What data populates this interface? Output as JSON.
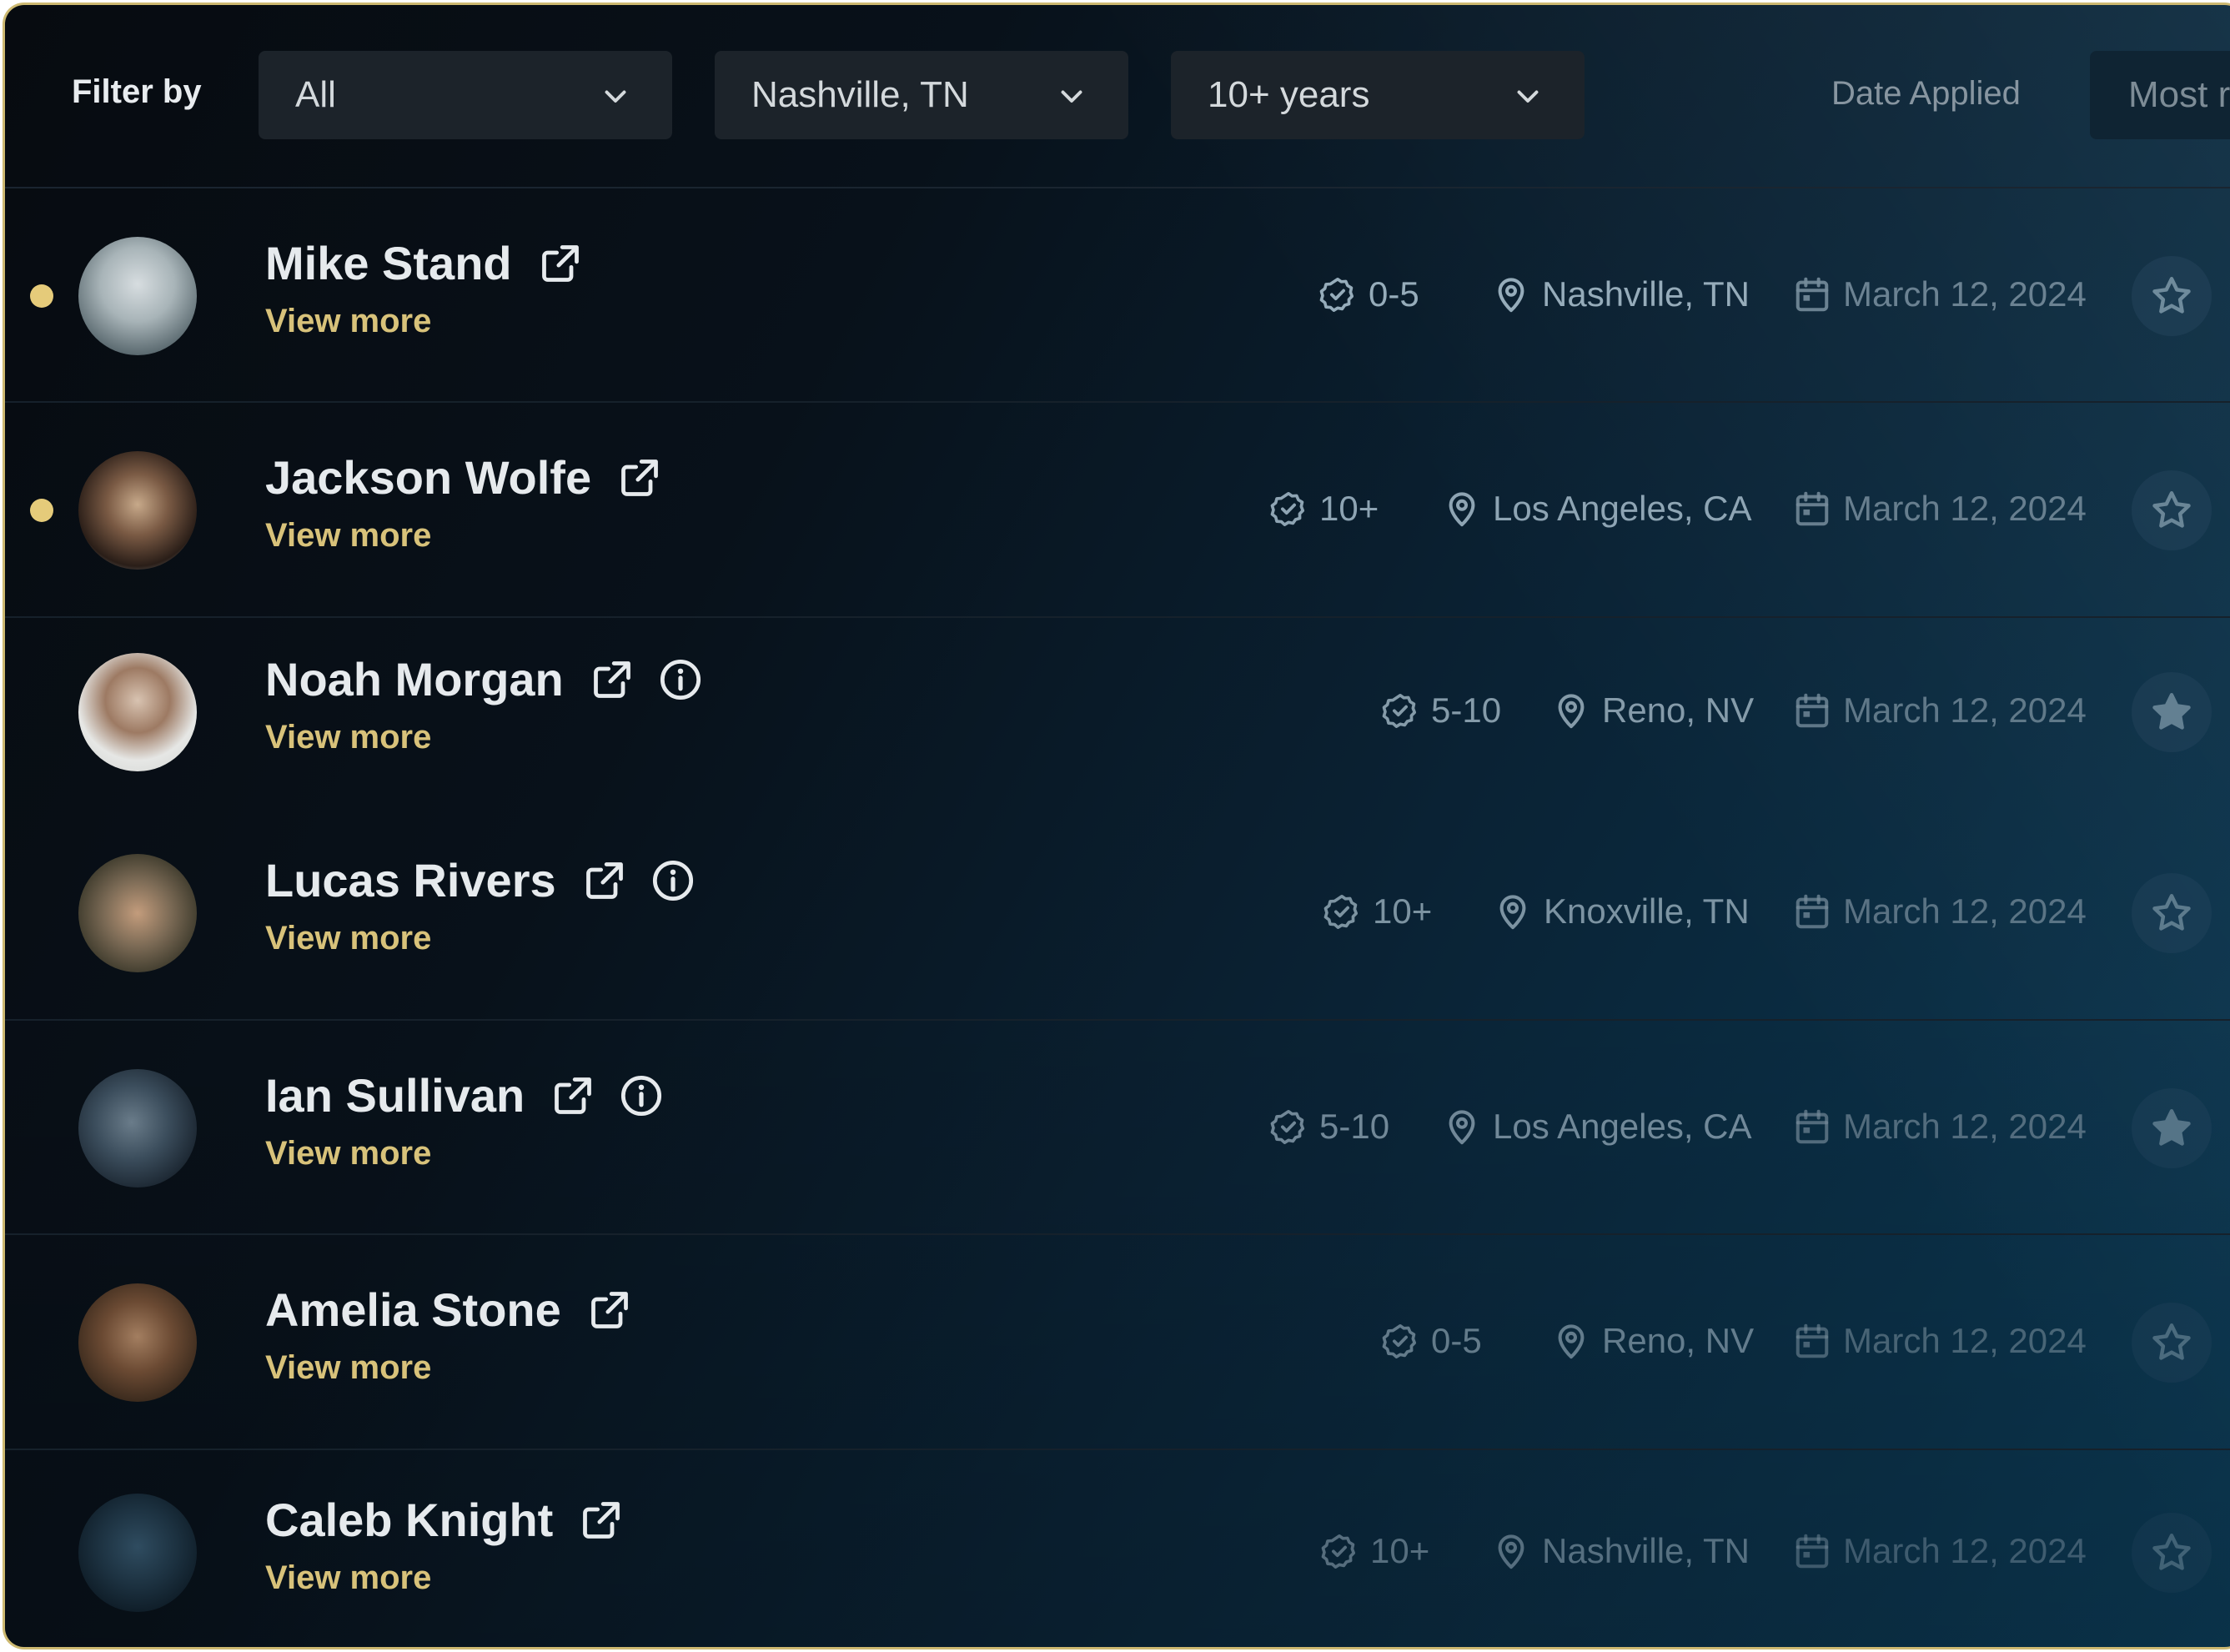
{
  "header": {
    "filter_label": "Filter by",
    "selects": [
      {
        "value": "All"
      },
      {
        "value": "Nashville, TN"
      },
      {
        "value": "10+ years"
      }
    ],
    "sort_label": "Date Applied",
    "sort_value": "Most r"
  },
  "colors": {
    "accent_gold": "#d8c27a",
    "unread_dot": "#e5cb7a",
    "background_dark": "#070b10",
    "background_teal": "#0b3a55"
  },
  "candidates": [
    {
      "name": "Mike Stand",
      "view_more": "View more",
      "experience": "0-5",
      "location": "Nashville, TN",
      "date": "March 12, 2024",
      "unread": true,
      "info": false,
      "starred": false
    },
    {
      "name": "Jackson Wolfe",
      "view_more": "View more",
      "experience": "10+",
      "location": "Los Angeles, CA",
      "date": "March 12, 2024",
      "unread": true,
      "info": false,
      "starred": false
    },
    {
      "name": "Noah Morgan",
      "view_more": "View more",
      "experience": "5-10",
      "location": "Reno, NV",
      "date": "March 12, 2024",
      "unread": false,
      "info": true,
      "starred": true
    },
    {
      "name": "Lucas Rivers",
      "view_more": "View more",
      "experience": "10+",
      "location": "Knoxville, TN",
      "date": "March 12, 2024",
      "unread": false,
      "info": true,
      "starred": false
    },
    {
      "name": "Ian Sullivan",
      "view_more": "View more",
      "experience": "5-10",
      "location": "Los Angeles, CA",
      "date": "March 12, 2024",
      "unread": false,
      "info": true,
      "starred": true
    },
    {
      "name": "Amelia Stone",
      "view_more": "View more",
      "experience": "0-5",
      "location": "Reno, NV",
      "date": "March 12, 2024",
      "unread": false,
      "info": false,
      "starred": false
    },
    {
      "name": "Caleb Knight",
      "view_more": "View more",
      "experience": "10+",
      "location": "Nashville, TN",
      "date": "March 12, 2024",
      "unread": false,
      "info": false,
      "starred": false
    }
  ]
}
